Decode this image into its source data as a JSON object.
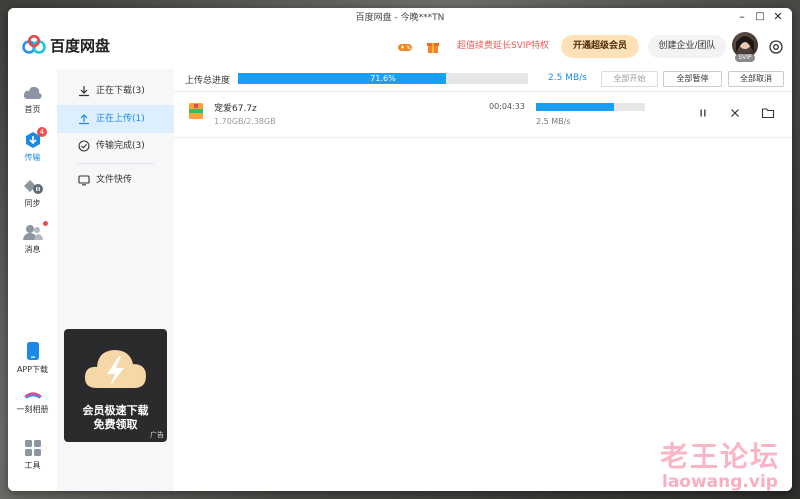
{
  "window": {
    "title": "百度网盘 - 今晚***TN",
    "minimize": "–",
    "maximize": "□",
    "close": "✕"
  },
  "topbar": {
    "logo_text": "百度网盘",
    "game_icon": "gamepad-icon",
    "gift_icon": "gift-icon",
    "promo_text": "超值续费延长SVIP特权",
    "svip_button": "开通超级会员",
    "enterprise_button": "创建企业/团队",
    "vip_tag": "SVIP",
    "settings_icon": "settings-icon"
  },
  "rail": {
    "items": [
      {
        "label": "首页",
        "icon": "cloud-icon"
      },
      {
        "label": "传输",
        "icon": "transfer-icon",
        "badge": "4"
      },
      {
        "label": "同步",
        "icon": "sync-icon"
      },
      {
        "label": "消息",
        "icon": "contacts-icon"
      },
      {
        "label": "APP下载",
        "icon": "phone-icon"
      },
      {
        "label": "一刻相册",
        "icon": "album-icon"
      },
      {
        "label": "工具",
        "icon": "tools-icon"
      }
    ]
  },
  "sidebar": {
    "items": [
      {
        "label": "正在下载(3)",
        "icon": "download-icon"
      },
      {
        "label": "正在上传(1)",
        "icon": "upload-icon"
      },
      {
        "label": "传输完成(3)",
        "icon": "check-circle-icon"
      },
      {
        "label": "文件快传",
        "icon": "monitor-icon"
      }
    ]
  },
  "ad": {
    "line1": "会员极速下载",
    "line2": "免费领取",
    "tag": "广告"
  },
  "upload": {
    "total_label": "上传总进度",
    "total_percent_text": "71.6%",
    "total_progress": 0.716,
    "total_speed": "2.5 MB/s",
    "buttons": {
      "start_all": "全部开始",
      "pause_all": "全部暂停",
      "cancel_all": "全部取消"
    },
    "rows": [
      {
        "name": "宠爱67.7z",
        "size": "1.70GB/2.38GB",
        "remaining": "00:04:33",
        "speed": "2.5 MB/s",
        "progress": 0.716
      }
    ]
  },
  "watermark": {
    "line1": "老王论坛",
    "line2": "laowang.vip"
  }
}
